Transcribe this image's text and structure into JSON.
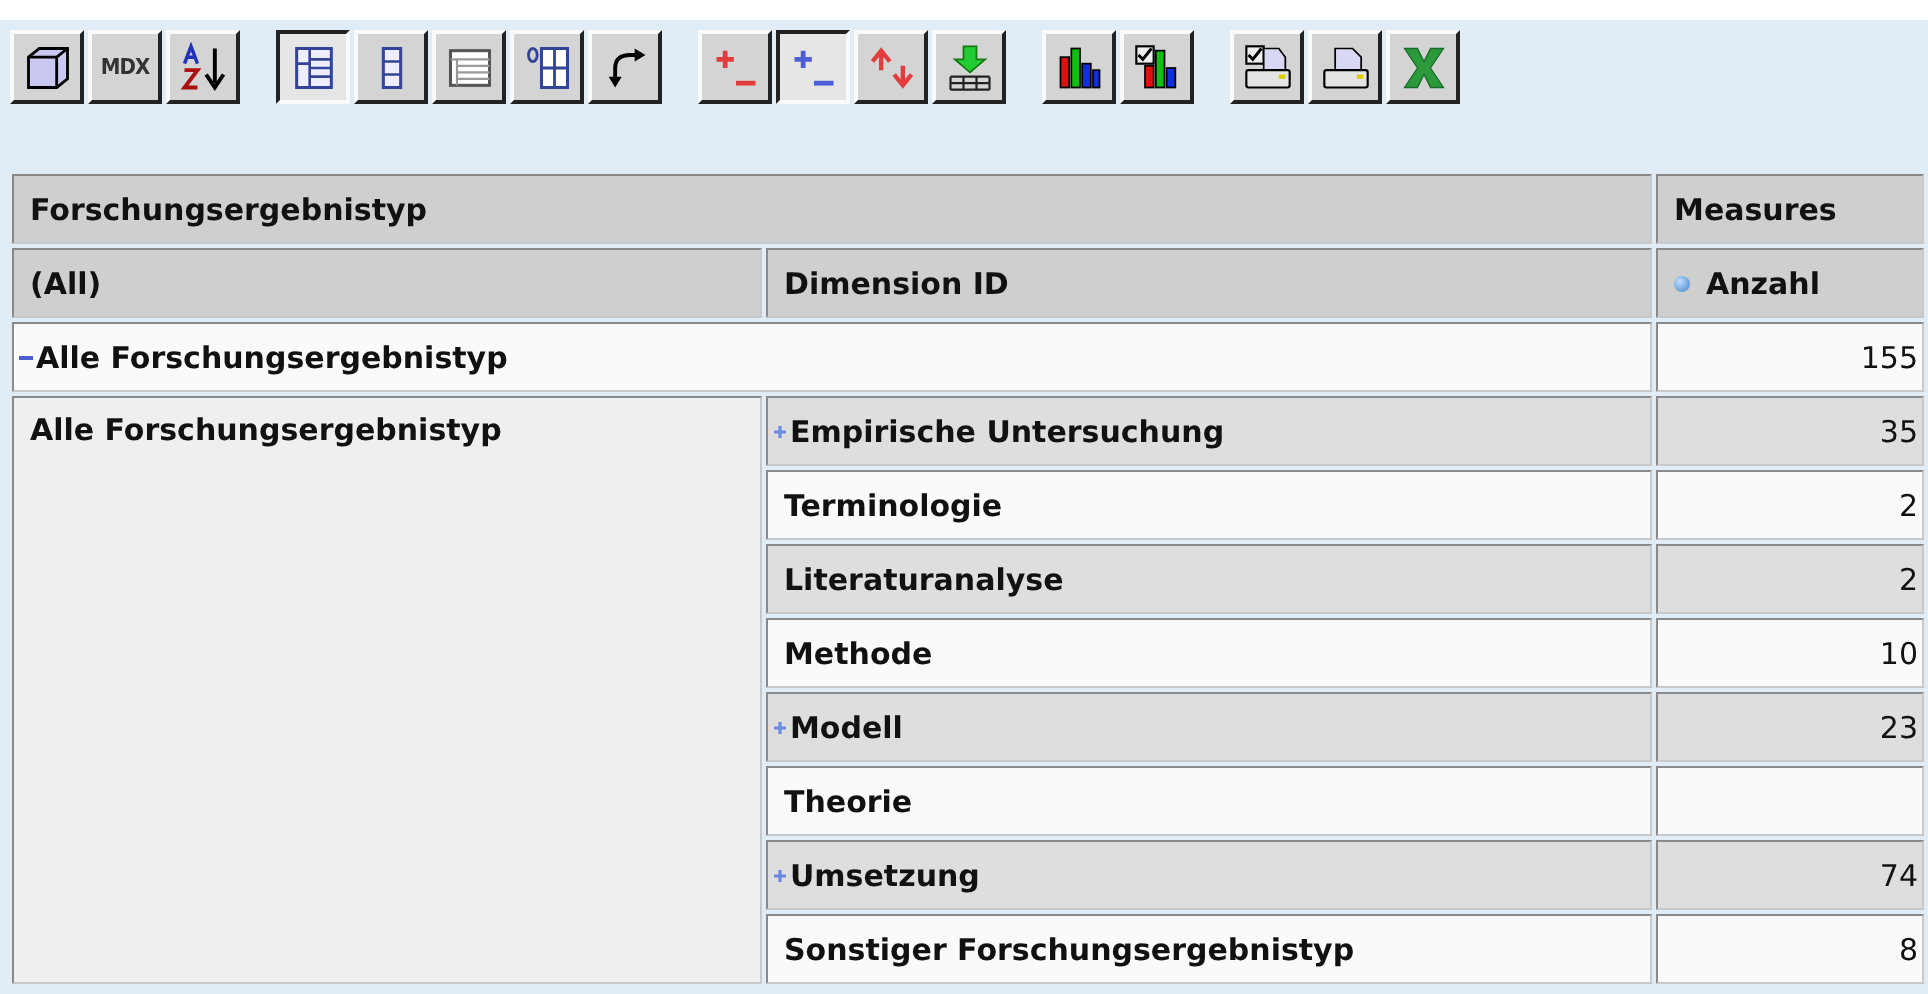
{
  "toolbar": {
    "groups": [
      [
        {
          "kind": "cube",
          "pressed": false
        },
        {
          "kind": "text",
          "label": "MDX",
          "pressed": false
        },
        {
          "kind": "sort",
          "pressed": false
        }
      ],
      [
        {
          "kind": "table-layout",
          "pressed": true
        },
        {
          "kind": "column-layout",
          "pressed": false
        },
        {
          "kind": "grid",
          "pressed": false
        },
        {
          "kind": "zero-grid",
          "pressed": false
        },
        {
          "kind": "swap",
          "pressed": false
        }
      ],
      [
        {
          "kind": "plus-minus-red",
          "pressed": false
        },
        {
          "kind": "plus-minus-blue",
          "pressed": true
        },
        {
          "kind": "up-down",
          "pressed": false
        },
        {
          "kind": "drill-down",
          "pressed": false
        }
      ],
      [
        {
          "kind": "chart",
          "pressed": false
        },
        {
          "kind": "chart-check",
          "pressed": false
        }
      ],
      [
        {
          "kind": "print-check",
          "pressed": false
        },
        {
          "kind": "print",
          "pressed": false
        },
        {
          "kind": "excel",
          "pressed": false
        }
      ]
    ]
  },
  "table": {
    "column_header": "Forschungsergebnistyp",
    "measures_header": "Measures",
    "filter": "(All)",
    "dimension_header": "Dimension ID",
    "measure": "Anzahl",
    "total": {
      "label": "Alle Forschungsergebnistyp",
      "expanded": true,
      "value": "155"
    },
    "group": {
      "label": "Alle Forschungsergebnistyp",
      "rows": [
        {
          "label": "Empirische Untersuchung",
          "expanded": false,
          "value": "35"
        },
        {
          "label": "Terminologie",
          "value": "2"
        },
        {
          "label": "Literaturanalyse",
          "value": "2"
        },
        {
          "label": "Methode",
          "value": "10"
        },
        {
          "label": "Modell",
          "expanded": false,
          "value": "23"
        },
        {
          "label": "Theorie"
        },
        {
          "label": "Umsetzung",
          "expanded": false,
          "value": "74"
        },
        {
          "label": "Sonstiger Forschungsergebnistyp",
          "value": "8"
        }
      ]
    }
  }
}
